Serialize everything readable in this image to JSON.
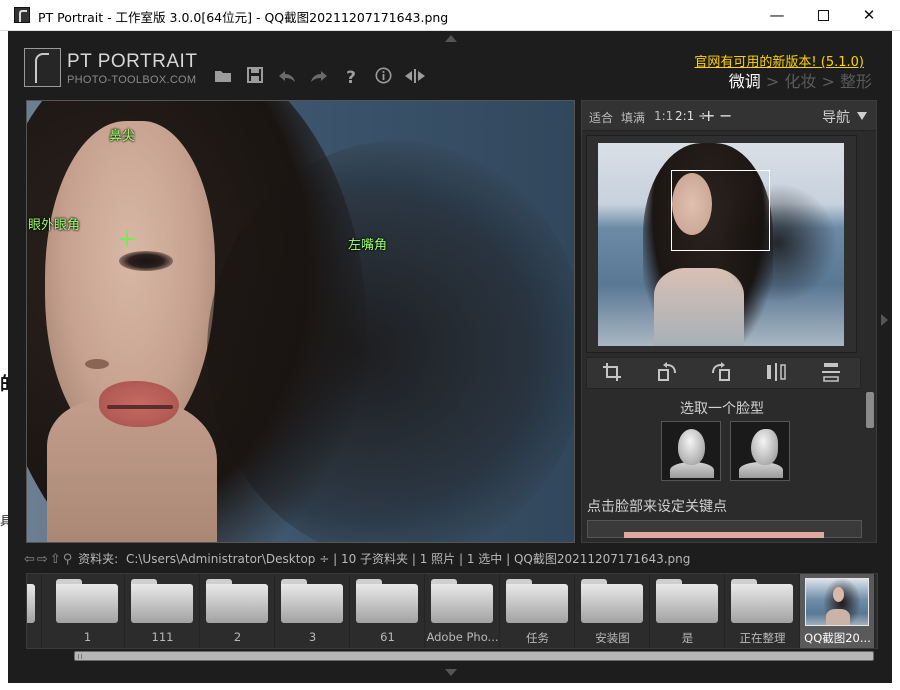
{
  "window": {
    "title": "PT Portrait - 工作室版 3.0.0[64位元] - QQ截图20211207171643.png",
    "minimize": "—",
    "close": "✕"
  },
  "brand": {
    "name": "PT PORTRAIT",
    "site": "PHOTO-TOOLBOX.COM"
  },
  "update_notice": "官网有可用的新版本! (5.1.0)",
  "modes": {
    "current": "微调",
    "sep1": " > ",
    "makeup": "化妆",
    "sep2": " > ",
    "reshape": "整形"
  },
  "keypoints": [
    {
      "label": "鼻尖"
    },
    {
      "label": "眼外眼角"
    },
    {
      "label": "左嘴角"
    }
  ],
  "navigator": {
    "fit": "适合",
    "fill": "填满",
    "one_to_one": "1:1",
    "zoom": "2:1 ÷",
    "plus": "+",
    "minus": "−",
    "label": "导航"
  },
  "face_select": {
    "title": "选取一个脸型"
  },
  "keypoint_hint": "点击脸部来设定关键点",
  "pathbar": {
    "folder_label": "资料夹:",
    "path": "C:\\Users\\Administrator\\Desktop ÷",
    "info": "| 10 子资料夹 | 1 照片 | 1 选中 | QQ截图20211207171643.png"
  },
  "files": [
    {
      "label": "1"
    },
    {
      "label": "111"
    },
    {
      "label": "2"
    },
    {
      "label": "3"
    },
    {
      "label": "61"
    },
    {
      "label": "Adobe Pho..."
    },
    {
      "label": "任务"
    },
    {
      "label": "安装图"
    },
    {
      "label": "是"
    },
    {
      "label": "正在整理"
    },
    {
      "label": "QQ截图20..."
    }
  ],
  "left_edge_text": [
    "的",
    "具"
  ]
}
